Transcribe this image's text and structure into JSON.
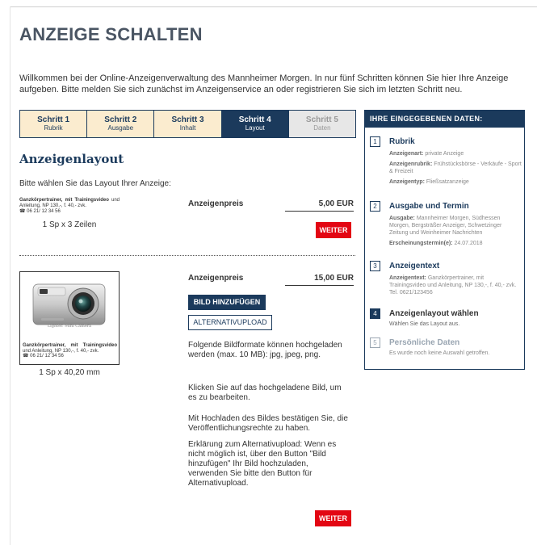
{
  "page": {
    "title": "ANZEIGE SCHALTEN",
    "intro": "Willkommen bei der Online-Anzeigenverwaltung des Mannheimer Morgen. In nur fünf Schritten können Sie hier Ihre Anzeige aufgeben. Bitte melden Sie sich zunächst im Anzeigenservice an oder registrieren Sie sich im letzten Schritt neu."
  },
  "steps": [
    {
      "title": "Schritt 1",
      "sub": "Rubrik",
      "state": "done"
    },
    {
      "title": "Schritt 2",
      "sub": "Ausgabe",
      "state": "done"
    },
    {
      "title": "Schritt 3",
      "sub": "Inhalt",
      "state": "done"
    },
    {
      "title": "Schritt 4",
      "sub": "Layout",
      "state": "active"
    },
    {
      "title": "Schritt 5",
      "sub": "Daten",
      "state": "future"
    }
  ],
  "layout": {
    "heading": "Anzeigenlayout",
    "prompt": "Bitte wählen Sie das Layout Ihrer Anzeige:",
    "option1": {
      "ad_bold": "Ganzkörpertrainer, mit Trainingsvideo",
      "ad_rest": "und Anleitung, NP 130,-, f. 40,- zvk.",
      "ad_phone": "☎ 06 21/ 12 34 56",
      "size": "1 Sp x 3 Zeilen",
      "price_label": "Anzeigenpreis",
      "price": "5,00 EUR",
      "button": "WEITER"
    },
    "option2": {
      "photo_caption": "Lighter. Mini Camera",
      "ad_bold": "Ganzkörpertrainer, mit Trainingsvideo",
      "ad_rest": "und Anleitung, NP 130,-, f. 40,- zvk.",
      "ad_phone": "☎ 06 21/ 12 34 56",
      "size": "1 Sp x 40,20 mm",
      "price_label": "Anzeigenpreis",
      "price": "15,00 EUR",
      "add_image_button": "BILD HINZUFÜGEN",
      "alt_upload_button": "ALTERNATIVUPLOAD",
      "info1": "Folgende Bildformate können hochgeladen werden (max. 10 MB): jpg, jpeg, png.",
      "info2": "Klicken Sie auf das hochgeladene Bild, um es zu bearbeiten.",
      "info3": "Mit Hochladen des Bildes bestätigen Sie, die Veröffentlichungsrechte zu haben.",
      "info4": "Erklärung zum Alternativupload: Wenn es nicht möglich ist, über den Button \"Bild hinzufügen\" Ihr Bild hochzuladen, verwenden Sie bitte den Button für Alternativupload.",
      "button": "WEITER"
    }
  },
  "sidebar": {
    "header": "IHRE EINGEGEBENEN DATEN:",
    "items": [
      {
        "num": "1",
        "title": "Rubrik",
        "lines": [
          {
            "label": "Anzeigenart:",
            "value": " private Anzeige"
          },
          {
            "label": "Anzeigenrubrik:",
            "value": " Frühstücksbörse - Verkäufe - Sport & Freizeit"
          },
          {
            "label": "Anzeigentyp:",
            "value": " Fließsatzanzeige"
          }
        ]
      },
      {
        "num": "2",
        "title": "Ausgabe und Termin",
        "lines": [
          {
            "label": "Ausgabe:",
            "value": " Mannheimer Morgen, Südhessen Morgen, Bergsträßer Anzeiger, Schwetzinger Zeitung und Weinheimer Nachrichten"
          },
          {
            "label": "Erscheinungstermin(e):",
            "value": " 24.07.2018"
          }
        ]
      },
      {
        "num": "3",
        "title": "Anzeigentext",
        "lines": [
          {
            "label": "Anzeigentext:",
            "value": " Ganzkörpertrainer, mit Trainingsvideo und Anleitung, NP 130,-, f. 40,- zvk. Tel. 0621/123456"
          }
        ]
      },
      {
        "num": "4",
        "title": "Anzeigenlayout wählen",
        "note": "Wählen Sie das Layout aus."
      },
      {
        "num": "5",
        "title": "Persönliche Daten",
        "note": "Es wurde noch keine Auswahl getroffen."
      }
    ]
  },
  "colors": {
    "navy": "#1b3a5c",
    "red": "#e30613",
    "step_done_bg": "#fbeccf"
  }
}
